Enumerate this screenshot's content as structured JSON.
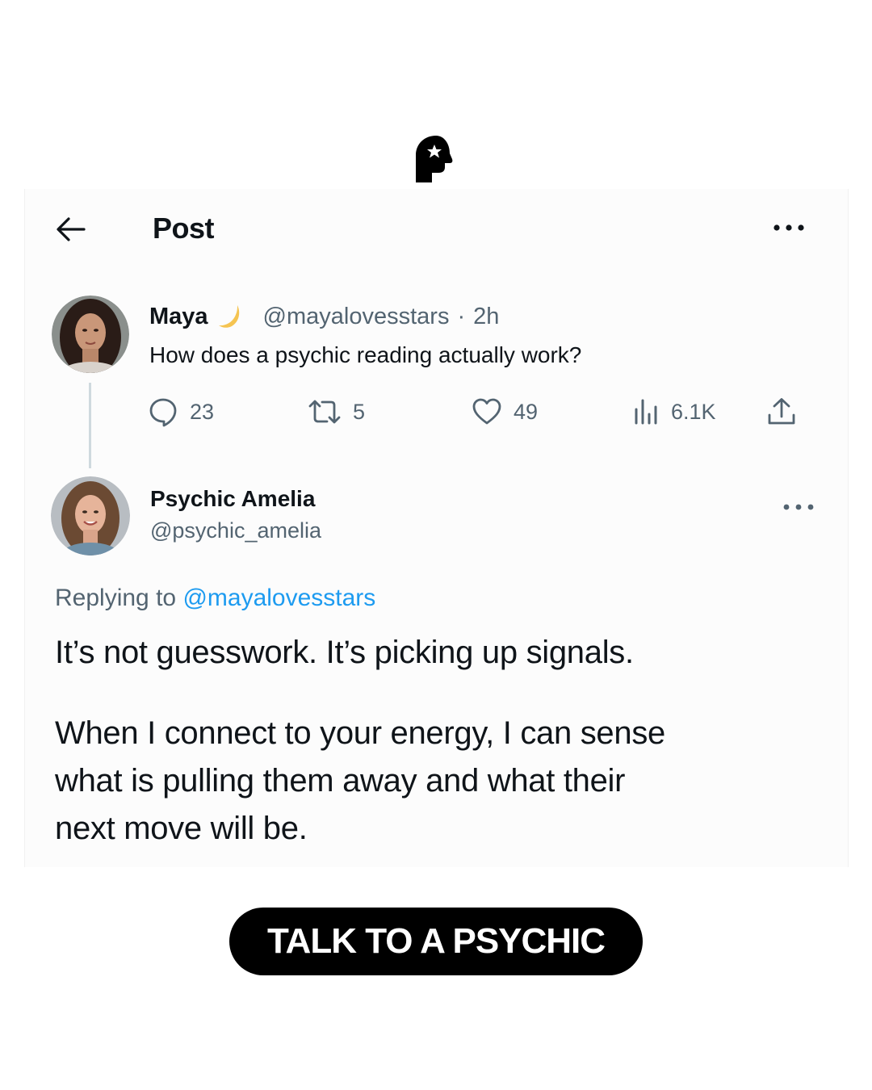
{
  "header": {
    "title": "Post",
    "back_icon": "arrow-left-icon",
    "more_icon": "more-horizontal-icon"
  },
  "original_post": {
    "name": "Maya",
    "emoji": "🌙",
    "handle": "@mayalovesstars",
    "separator": "·",
    "time": "2h",
    "text": "How does a psychic reading actually work?",
    "actions": {
      "replies": "23",
      "retweets": "5",
      "likes": "49",
      "views": "6.1K"
    }
  },
  "reply_post": {
    "name": "Psychic Amelia",
    "handle": "@psychic_amelia",
    "replying_prefix": "Replying to",
    "replying_handle": "@mayalovesstars",
    "lines": [
      "It’s not guesswork. It’s picking up signals.",
      "When I connect to your energy, I can sense",
      "what is pulling them away and what their",
      "next move will be."
    ]
  },
  "cta": {
    "label": "TALK TO A PSYCHIC"
  },
  "colors": {
    "text": "#0f1419",
    "secondary": "#536471",
    "link": "#1d9bf0",
    "cta_bg": "#000000",
    "cta_text": "#ffffff"
  }
}
